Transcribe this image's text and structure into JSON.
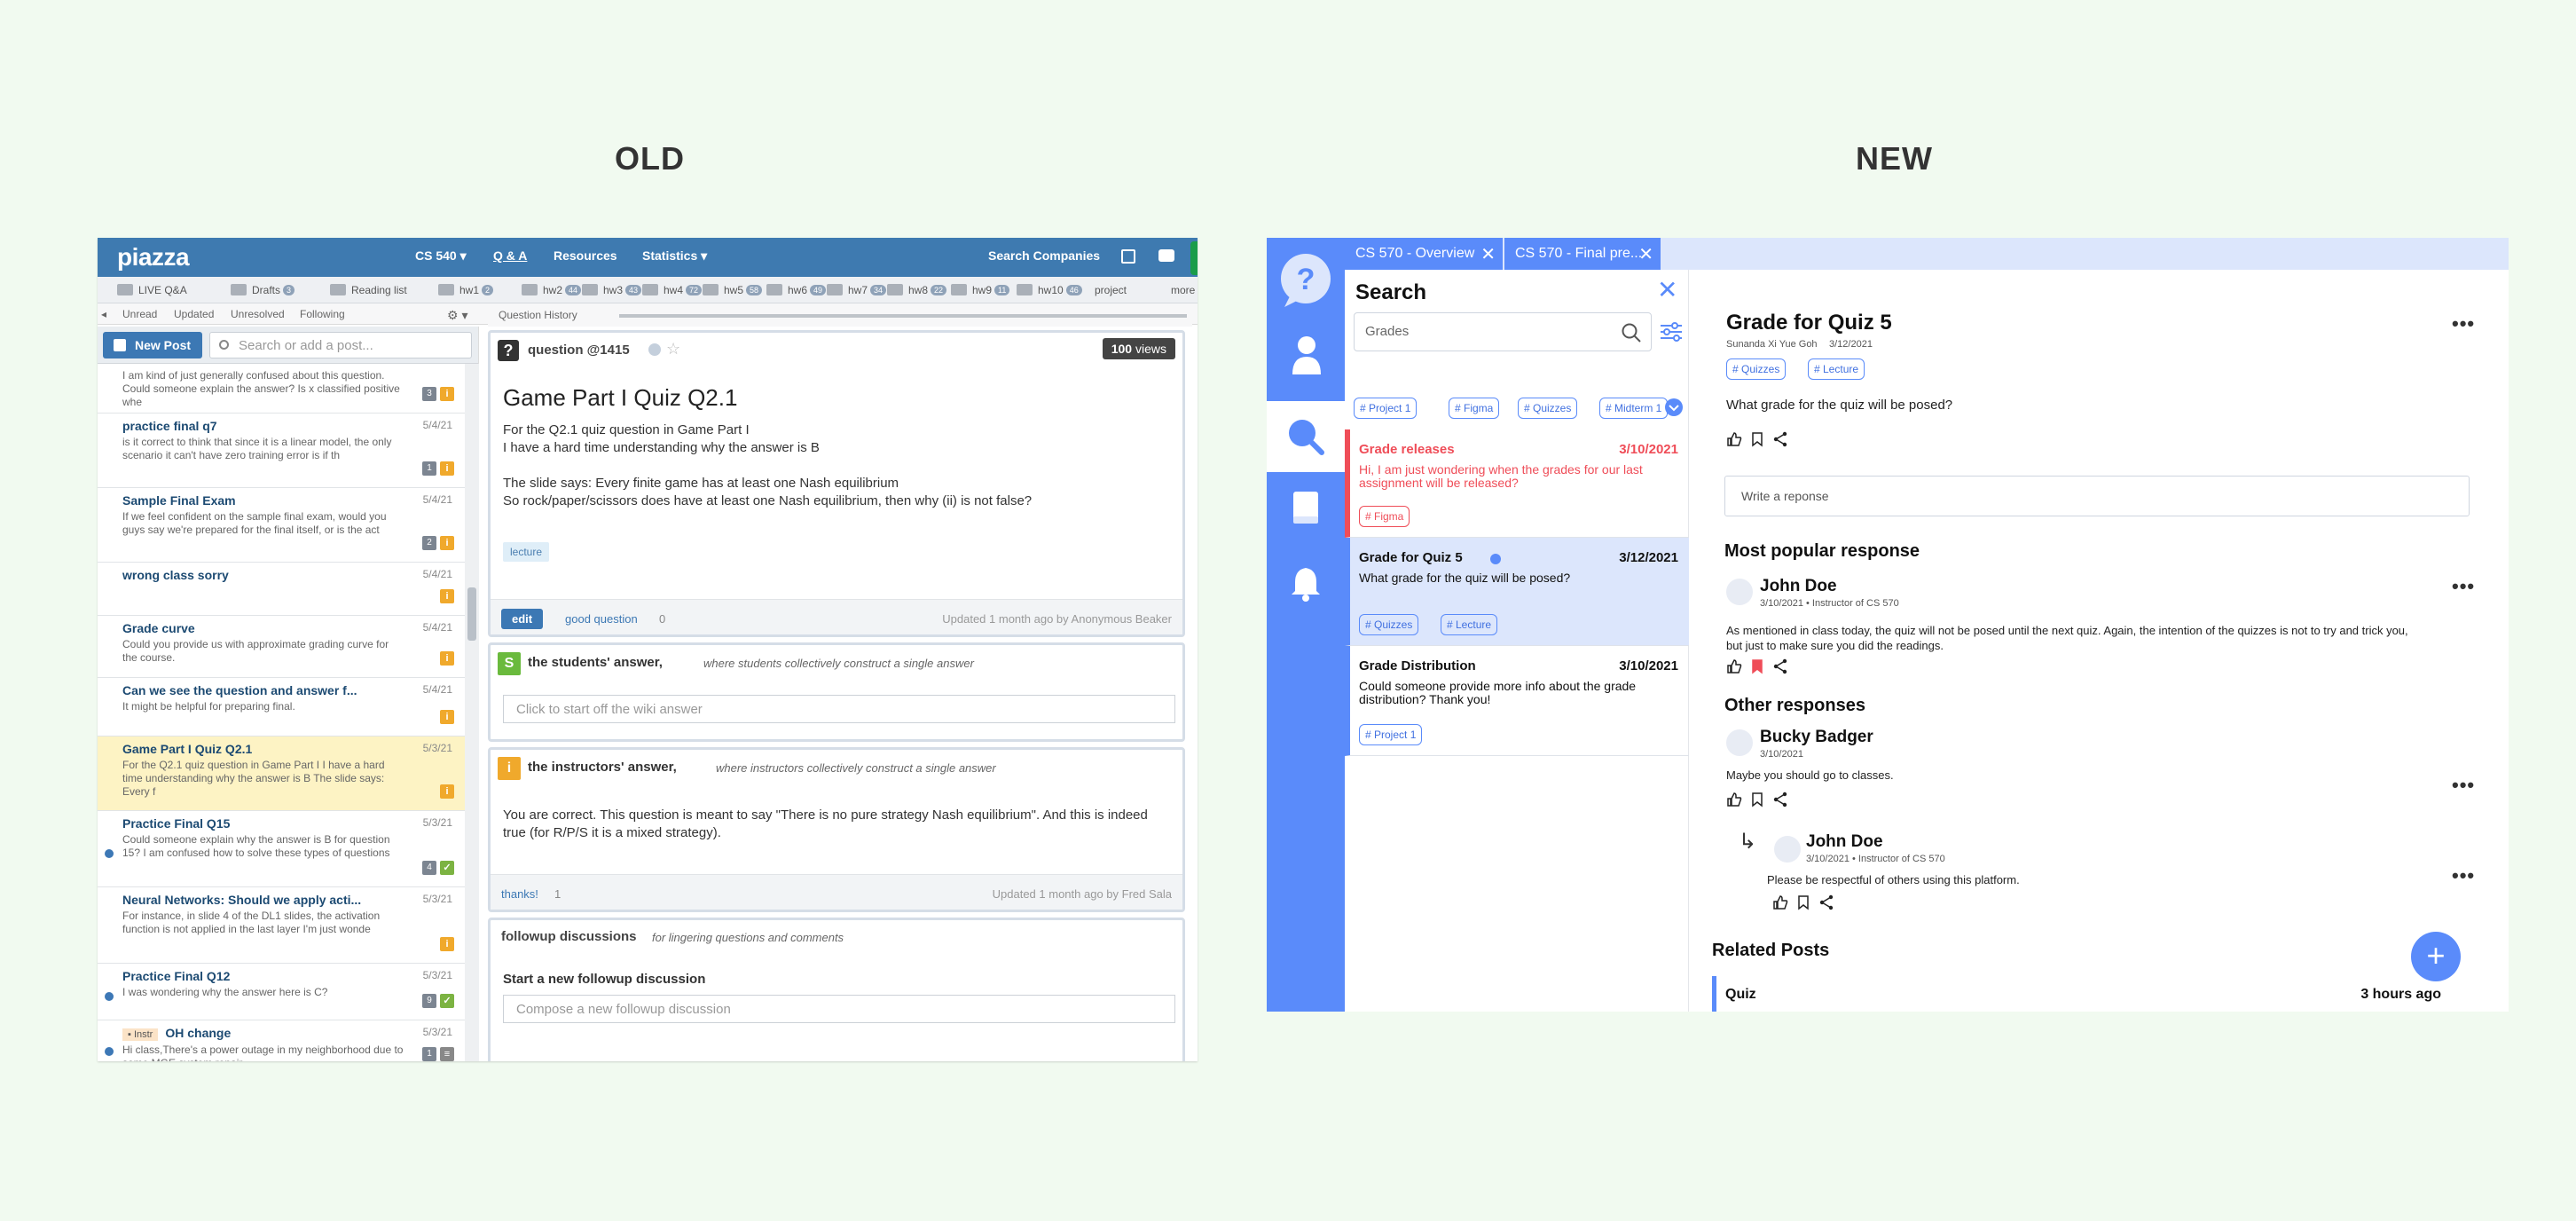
{
  "headers": {
    "old": "OLD",
    "new": "NEW"
  },
  "old": {
    "logo": "piazza",
    "nav": {
      "course": "CS 540",
      "qa": "Q & A",
      "resources": "Resources",
      "statistics": "Statistics",
      "search_companies": "Search Companies"
    },
    "folders": [
      {
        "label": "LIVE Q&A",
        "count": ""
      },
      {
        "label": "Drafts",
        "count": "3"
      },
      {
        "label": "Reading list",
        "count": ""
      },
      {
        "label": "hw1",
        "count": "2"
      },
      {
        "label": "hw2",
        "count": "44"
      },
      {
        "label": "hw3",
        "count": "43"
      },
      {
        "label": "hw4",
        "count": "72"
      },
      {
        "label": "hw5",
        "count": "58"
      },
      {
        "label": "hw6",
        "count": "49"
      },
      {
        "label": "hw7",
        "count": "34"
      },
      {
        "label": "hw8",
        "count": "22"
      },
      {
        "label": "hw9",
        "count": "11"
      },
      {
        "label": "hw10",
        "count": "46"
      },
      {
        "label": "project",
        "count": ""
      },
      {
        "label": "more",
        "count": ""
      }
    ],
    "filters": {
      "unread": "Unread",
      "updated": "Updated",
      "unresolved": "Unresolved",
      "following": "Following",
      "history": "Question History"
    },
    "new_post": "New Post",
    "search_placeholder": "Search or add a post...",
    "posts": [
      {
        "title": "",
        "snippet": "I am kind of just generally confused about this question. Could someone explain the answer? Is x classified positive whe",
        "date": "",
        "count": "3"
      },
      {
        "title": "practice final q7",
        "snippet": "is it correct to think that since it is a linear model, the only scenario it can't have zero training error is if th",
        "date": "5/4/21",
        "count": "1"
      },
      {
        "title": "Sample Final Exam",
        "snippet": "If we feel confident on the sample final exam, would you guys say we're prepared for the final itself, or is the act",
        "date": "5/4/21",
        "count": "2"
      },
      {
        "title": "wrong class sorry",
        "snippet": "",
        "date": "5/4/21",
        "count": ""
      },
      {
        "title": "Grade curve",
        "snippet": "Could you provide us with approximate grading curve for the course.",
        "date": "5/4/21",
        "count": ""
      },
      {
        "title": "Can we see the question and answer f...",
        "snippet": "It might be helpful for preparing final.",
        "date": "5/4/21",
        "count": ""
      },
      {
        "title": "Game Part I Quiz Q2.1",
        "snippet": "For the Q2.1 quiz question in Game Part I  I have a hard time understanding why the answer is B The slide says: Every f",
        "date": "5/3/21",
        "count": ""
      },
      {
        "title": "Practice Final Q15",
        "snippet": "Could someone explain why the answer is B for question 15? I am confused how to solve these types of questions",
        "date": "5/3/21",
        "count": "4"
      },
      {
        "title": "Neural Networks: Should we apply acti...",
        "snippet": "For instance, in slide 4 of the DL1 slides, the activation function is not applied in the last layer I'm just wonde",
        "date": "5/3/21",
        "count": ""
      },
      {
        "title": "Practice Final Q12",
        "snippet": "I was wondering why the answer here is C?",
        "date": "5/3/21",
        "count": "9"
      },
      {
        "title": "OH change",
        "snippet": "Hi class,There's a power outage in my neighborhood due to some MGE system repair",
        "date": "5/3/21",
        "count": "1",
        "tag": "Instr"
      }
    ],
    "question": {
      "number": "question @1415",
      "views": "100",
      "views_label": "views",
      "title": "Game Part I Quiz Q2.1",
      "body": [
        "For the Q2.1 quiz question in Game Part I",
        "I have a hard time understanding why the answer is B",
        "",
        "The slide says: Every finite game has at least one Nash equilibrium",
        "So rock/paper/scissors does have at least one Nash equilibrium, then why (ii) is not false?"
      ],
      "tag": "lecture",
      "edit": "edit",
      "good_question": "good question",
      "good_count": "0",
      "updated": "Updated 1 month ago by Anonymous Beaker"
    },
    "students_answer": {
      "letter": "S",
      "title": "the students' answer,",
      "subtitle": "where students collectively construct a single answer",
      "placeholder": "Click to start off the wiki answer"
    },
    "instructors_answer": {
      "letter": "i",
      "title": "the instructors' answer,",
      "subtitle": "where instructors collectively construct a single answer",
      "body": "You are correct. This question is meant to say \"There is no pure strategy Nash equilibrium\". And this is indeed true (for R/P/S it is a mixed strategy).",
      "thanks": "thanks!",
      "thanks_count": "1",
      "updated": "Updated 1 month ago by Fred Sala"
    },
    "followup": {
      "title": "followup discussions",
      "subtitle": "for lingering questions and comments",
      "start": "Start a new followup discussion",
      "placeholder": "Compose a new followup discussion"
    }
  },
  "new": {
    "tabs": [
      "CS 570 - Overview",
      "CS 570 - Final pre..."
    ],
    "search": {
      "title": "Search",
      "value": "Grades",
      "chips": [
        "Project 1",
        "Figma",
        "Quizzes",
        "Midterm 1"
      ]
    },
    "results": [
      {
        "title": "Grade releases",
        "date": "3/10/2021",
        "body": "Hi, I am just wondering when the grades for our last assignment will be released?",
        "tags": [
          "Figma"
        ],
        "color": "#ef4d58"
      },
      {
        "title": "Grade for Quiz 5",
        "date": "3/12/2021",
        "body": "What grade for the quiz will be posed?",
        "tags": [
          "Quizzes",
          "Lecture"
        ],
        "color": "#111111"
      },
      {
        "title": "Grade Distribution",
        "date": "3/10/2021",
        "body": "Could someone provide more info about the grade distribution? Thank you!",
        "tags": [
          "Project 1"
        ],
        "color": "#111111"
      }
    ],
    "post": {
      "title": "Grade for Quiz 5",
      "author": "Sunanda Xi Yue Goh",
      "date": "3/12/2021",
      "tags": [
        "Quizzes",
        "Lecture"
      ],
      "body": "What grade for the quiz will be posed?",
      "reply_placeholder": "Write a reponse"
    },
    "popular": {
      "heading": "Most popular response",
      "name": "John Doe",
      "meta": "3/10/2021 • Instructor of CS 570",
      "body": "As mentioned in class today, the quiz will not be posed until the next quiz. Again, the intention of the quizzes is not to try and trick you, but just to make sure you did the readings."
    },
    "other": {
      "heading": "Other responses",
      "name": "Bucky Badger",
      "meta": "3/10/2021",
      "body": "Maybe you should go to classes."
    },
    "reply": {
      "name": "John Doe",
      "meta": "3/10/2021 • Instructor of CS 570",
      "body": "Please be respectful of others using this platform."
    },
    "related": {
      "heading": "Related Posts",
      "item": "Quiz",
      "time": "3 hours ago"
    },
    "colors": {
      "accent": "#5a8bfa",
      "danger": "#ef4d58"
    }
  }
}
